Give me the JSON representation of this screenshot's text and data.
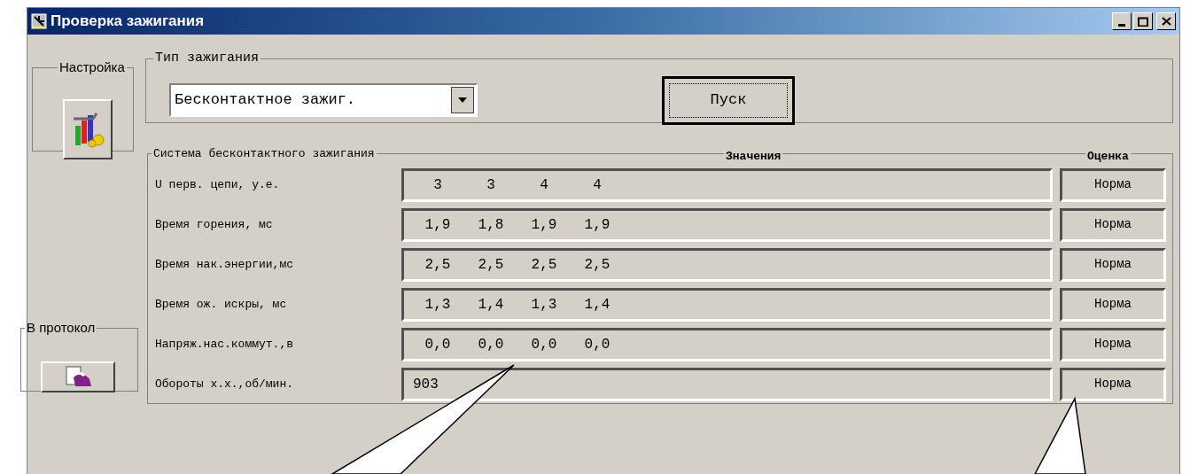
{
  "window": {
    "title": "Проверка зажигания"
  },
  "settings_group": {
    "label": "Настройка"
  },
  "protocol_group": {
    "label": "В протокол"
  },
  "ignition_type": {
    "label": "Тип зажигания",
    "value": "Бесконтактное зажиг."
  },
  "start_button": {
    "label": "Пуск"
  },
  "system": {
    "label": "Система бесконтактного зажигания",
    "values_header": "Значения",
    "rating_header": "Оценка",
    "rows": [
      {
        "label": "U перв. цепи, у.е.",
        "values": [
          "3",
          "3",
          "4",
          "4"
        ],
        "rating": "Норма"
      },
      {
        "label": "Время горения, мс",
        "values": [
          "1,9",
          "1,8",
          "1,9",
          "1,9"
        ],
        "rating": "Норма"
      },
      {
        "label": "Время нак.энергии,мс",
        "values": [
          "2,5",
          "2,5",
          "2,5",
          "2,5"
        ],
        "rating": "Норма"
      },
      {
        "label": "Время ож. искры, мс",
        "values": [
          "1,3",
          "1,4",
          "1,3",
          "1,4"
        ],
        "rating": "Норма"
      },
      {
        "label": "Напряж.нас.коммут.,в",
        "values": [
          "0,0",
          "0,0",
          "0,0",
          "0,0"
        ],
        "rating": "Норма"
      },
      {
        "label": "Обороты х.х.,об/мин.",
        "values": [
          "903"
        ],
        "rating": "Норма"
      }
    ]
  }
}
